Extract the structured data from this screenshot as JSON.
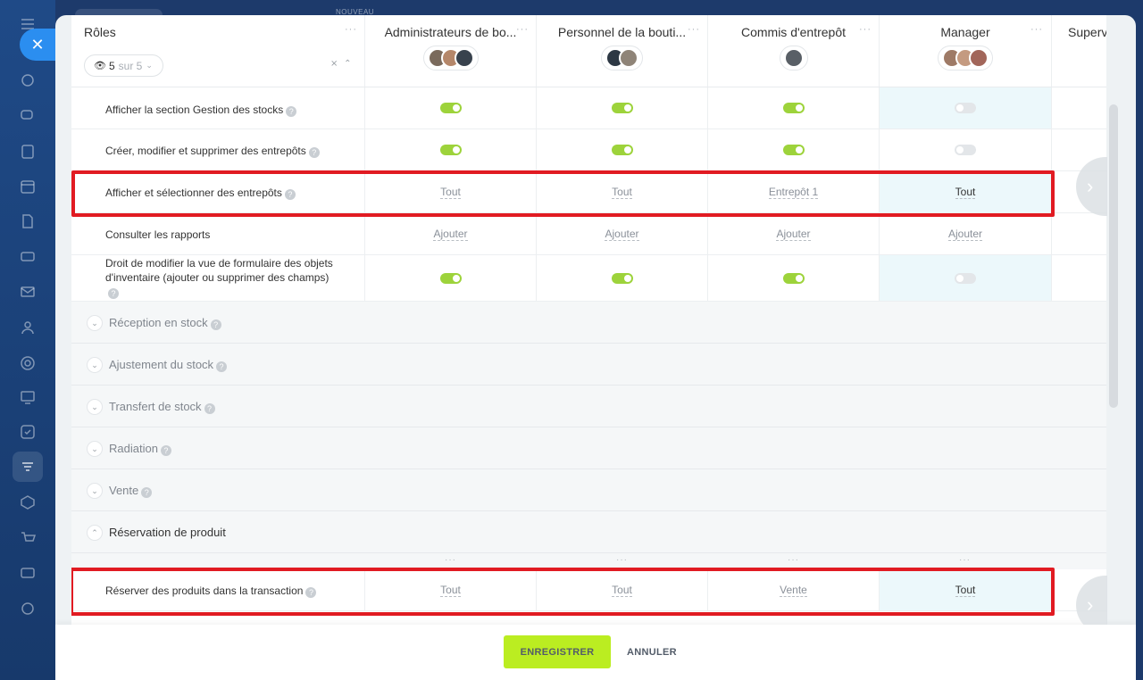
{
  "background": {
    "new_label": "NOUVEAU"
  },
  "header": {
    "roles_title": "Rôles",
    "counter": {
      "shown": "5",
      "rest": "sur 5"
    },
    "roles": [
      {
        "name": "Administrateurs de bo..."
      },
      {
        "name": "Personnel de la bouti..."
      },
      {
        "name": "Commis d'entrepôt"
      },
      {
        "name": "Manager"
      },
      {
        "name": "Superv"
      }
    ]
  },
  "rows": [
    {
      "label": "Afficher la section Gestion des stocks",
      "values": [
        "on",
        "on",
        "on",
        "off"
      ]
    },
    {
      "label": "Créer, modifier et supprimer des entrepôts",
      "values": [
        "on",
        "on",
        "on",
        "off"
      ]
    },
    {
      "label": "Afficher et sélectionner des entrepôts",
      "values": [
        "Tout",
        "Tout",
        "Entrepôt 1",
        "Tout"
      ]
    },
    {
      "label": "Consulter les rapports",
      "values": [
        "Ajouter",
        "Ajouter",
        "Ajouter",
        "Ajouter"
      ]
    },
    {
      "label": "Droit de modifier la vue de formulaire des objets d'inventaire (ajouter ou supprimer des champs)",
      "values": [
        "on",
        "on",
        "on",
        "off"
      ]
    }
  ],
  "sections": [
    {
      "title": "Réception en stock",
      "expanded": false
    },
    {
      "title": "Ajustement du stock",
      "expanded": false
    },
    {
      "title": "Transfert de stock",
      "expanded": false
    },
    {
      "title": "Radiation",
      "expanded": false
    },
    {
      "title": "Vente",
      "expanded": false
    },
    {
      "title": "Réservation de produit",
      "expanded": true
    }
  ],
  "reservation_row": {
    "label": "Réserver des produits dans la transaction",
    "values": [
      "Tout",
      "Tout",
      "Vente",
      "Tout"
    ]
  },
  "footer": {
    "save_label": "ENREGISTRER",
    "cancel_label": "ANNULER"
  },
  "colors": {
    "toggle_on": "#9dd33b",
    "highlight_column": "#ecf8fb",
    "annotation_red": "#e11b22",
    "save_button": "#bbed21"
  }
}
